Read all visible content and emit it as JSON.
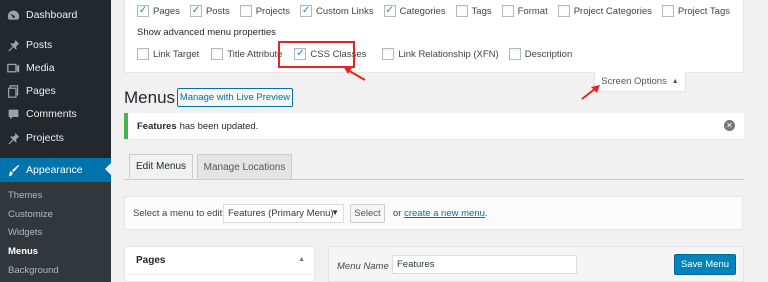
{
  "sidebar": {
    "items": [
      {
        "label": "Dashboard",
        "icon": "dashboard-icon"
      },
      {
        "label": "Posts",
        "icon": "pin-icon"
      },
      {
        "label": "Media",
        "icon": "media-icon"
      },
      {
        "label": "Pages",
        "icon": "pages-icon"
      },
      {
        "label": "Comments",
        "icon": "comment-icon"
      },
      {
        "label": "Projects",
        "icon": "pin-icon"
      },
      {
        "label": "Appearance",
        "icon": "brush-icon"
      }
    ],
    "submenu": [
      "Themes",
      "Customize",
      "Widgets",
      "Menus",
      "Background"
    ]
  },
  "screen_options": {
    "boxes_row": [
      {
        "label": "Pages",
        "checked": true
      },
      {
        "label": "Posts",
        "checked": true
      },
      {
        "label": "Projects",
        "checked": false
      },
      {
        "label": "Custom Links",
        "checked": true
      },
      {
        "label": "Categories",
        "checked": true
      },
      {
        "label": "Tags",
        "checked": false
      },
      {
        "label": "Format",
        "checked": false
      },
      {
        "label": "Project Categories",
        "checked": false
      },
      {
        "label": "Project Tags",
        "checked": false
      }
    ],
    "advanced_heading": "Show advanced menu properties",
    "advanced_row": [
      {
        "label": "Link Target",
        "checked": false
      },
      {
        "label": "Title Attribute",
        "checked": false
      },
      {
        "label": "CSS Classes",
        "checked": true
      },
      {
        "label": "Link Relationship (XFN)",
        "checked": false
      },
      {
        "label": "Description",
        "checked": false
      }
    ],
    "tab_label": "Screen Options",
    "tab_arrow": "▲"
  },
  "header": {
    "title": "Menus",
    "preview_button": "Manage with Live Preview"
  },
  "notice": {
    "strong": "Features",
    "text": "has been updated.",
    "dismiss": "✕"
  },
  "tabs": {
    "edit": "Edit Menus",
    "manage": "Manage Locations"
  },
  "select_bar": {
    "label": "Select a menu to edit:",
    "selected": "Features (Primary Menu)",
    "button": "Select",
    "or_text": "or",
    "create_link": "create a new menu",
    "period": "."
  },
  "pages_panel": {
    "title": "Pages",
    "caret": "▲"
  },
  "menu_name": {
    "label": "Menu Name",
    "value": "Features",
    "save_button": "Save Menu"
  },
  "colors": {
    "accent": "#0073aa",
    "highlight_box": "#e22626",
    "notice_success": "#46b450",
    "primary_button": "#0085ba"
  }
}
